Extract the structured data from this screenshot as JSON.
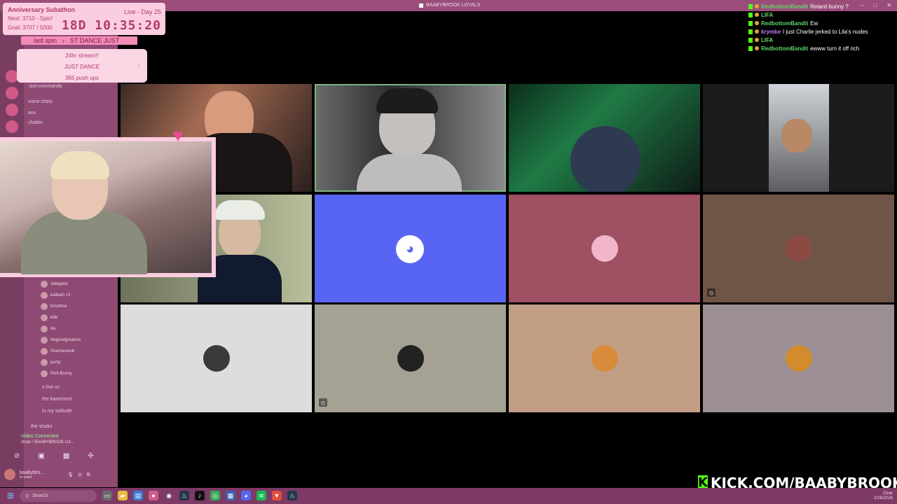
{
  "window": {
    "title": "BAABYBROOK LOYALS"
  },
  "overlay": {
    "title": "Anniversary Subathon",
    "next": "Next: 3710 - Spin!",
    "goal": "Goal: 3707 / 5000",
    "live_day": "Live - Day 25",
    "timer": "18D 10:35:20",
    "last_spin_label": "last spin",
    "last_spin_value": "ST DANCE JUST",
    "spin_items": [
      "24hr stream!!",
      "JUST DANCE",
      "365 push ups"
    ]
  },
  "sidebar": {
    "channels": [
      "-bot-commands",
      "voice chats",
      "aux",
      "chattin"
    ],
    "members": [
      "Jabajawz",
      "kalliash <3",
      "Kmsthne",
      "kille",
      "lila",
      "Nogoodgreature",
      "Peacheswub",
      "porky",
      "Rich Bunny"
    ],
    "voice_channels": [
      "o live vc",
      "the basement",
      "in my solitude",
      "the studio"
    ],
    "voice_status": "Video Connected",
    "voice_sub": "chats / BAABYBROOK LO...",
    "username": "baabybro...",
    "user_status": "In voice"
  },
  "chat": [
    {
      "user": "RedbottomBandit",
      "msg": "Retard bunny ?"
    },
    {
      "user": "LIFA",
      "msg": ""
    },
    {
      "user": "RedbottomBandit",
      "msg": "Ew"
    },
    {
      "user": "krymke",
      "msg": "I just Charlie jerked to Lila's nudes"
    },
    {
      "user": "LIFA",
      "msg": ""
    },
    {
      "user": "RedbottomBandit",
      "msg": "ewww turn it off rich"
    }
  ],
  "banner": {
    "k": "K",
    "text": "KICK.COM/BAABYBROOK"
  },
  "taskbar": {
    "search": "Search",
    "time": "Clear",
    "date": "2/26/2026"
  },
  "colors": {
    "accent": "#9b4d7a",
    "kick_green": "#53fc18",
    "discord_blurple": "#5865f2"
  }
}
